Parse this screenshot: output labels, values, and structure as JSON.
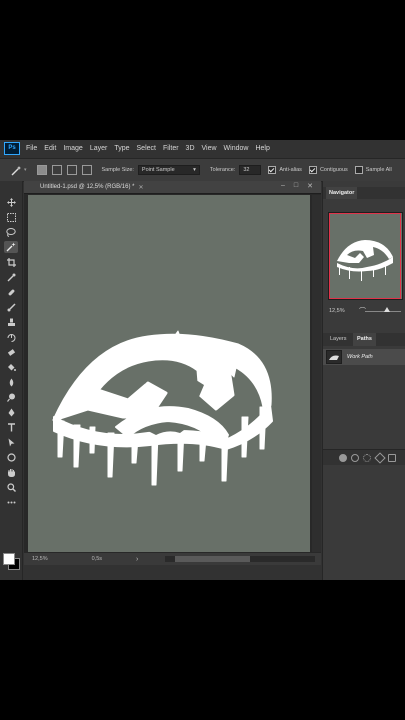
{
  "app": {
    "logo": "Ps"
  },
  "menu": [
    "File",
    "Edit",
    "Image",
    "Layer",
    "Type",
    "Select",
    "Filter",
    "3D",
    "View",
    "Window",
    "Help"
  ],
  "options": {
    "sample_size_label": "Sample Size:",
    "sample_size_value": "Point Sample",
    "tolerance_label": "Tolerance:",
    "tolerance_value": "32",
    "anti_alias_label": "Anti-alias",
    "anti_alias_checked": true,
    "contiguous_label": "Contiguous",
    "contiguous_checked": true,
    "sample_all_label": "Sample All",
    "sample_all_checked": false
  },
  "tools": [
    "move-icon",
    "marquee-icon",
    "lasso-icon",
    "magic-wand-icon",
    "crop-icon",
    "eyedropper-icon",
    "healing-brush-icon",
    "brush-icon",
    "clone-stamp-icon",
    "history-brush-icon",
    "eraser-icon",
    "paint-bucket-icon",
    "blur-icon",
    "dodge-icon",
    "pen-icon",
    "type-icon",
    "path-selection-icon",
    "shape-icon",
    "hand-icon",
    "zoom-icon",
    "more-tools-icon"
  ],
  "document": {
    "tab_title": "Untitled-1.psd @ 12,5% (RGB/16) *",
    "canvas_color": "#687068",
    "zoom_status": "12,5%",
    "size_status": "0,5s"
  },
  "navigator": {
    "tab": "Navigator",
    "zoom_value": "12,5%",
    "view_box_color": "#e0334a"
  },
  "paths_panel": {
    "tabs": [
      "Layers",
      "Paths"
    ],
    "active_tab": "Paths",
    "items": [
      {
        "name": "Work Path"
      }
    ]
  },
  "colors": {
    "foreground": "#ffffff",
    "background": "#000000"
  }
}
